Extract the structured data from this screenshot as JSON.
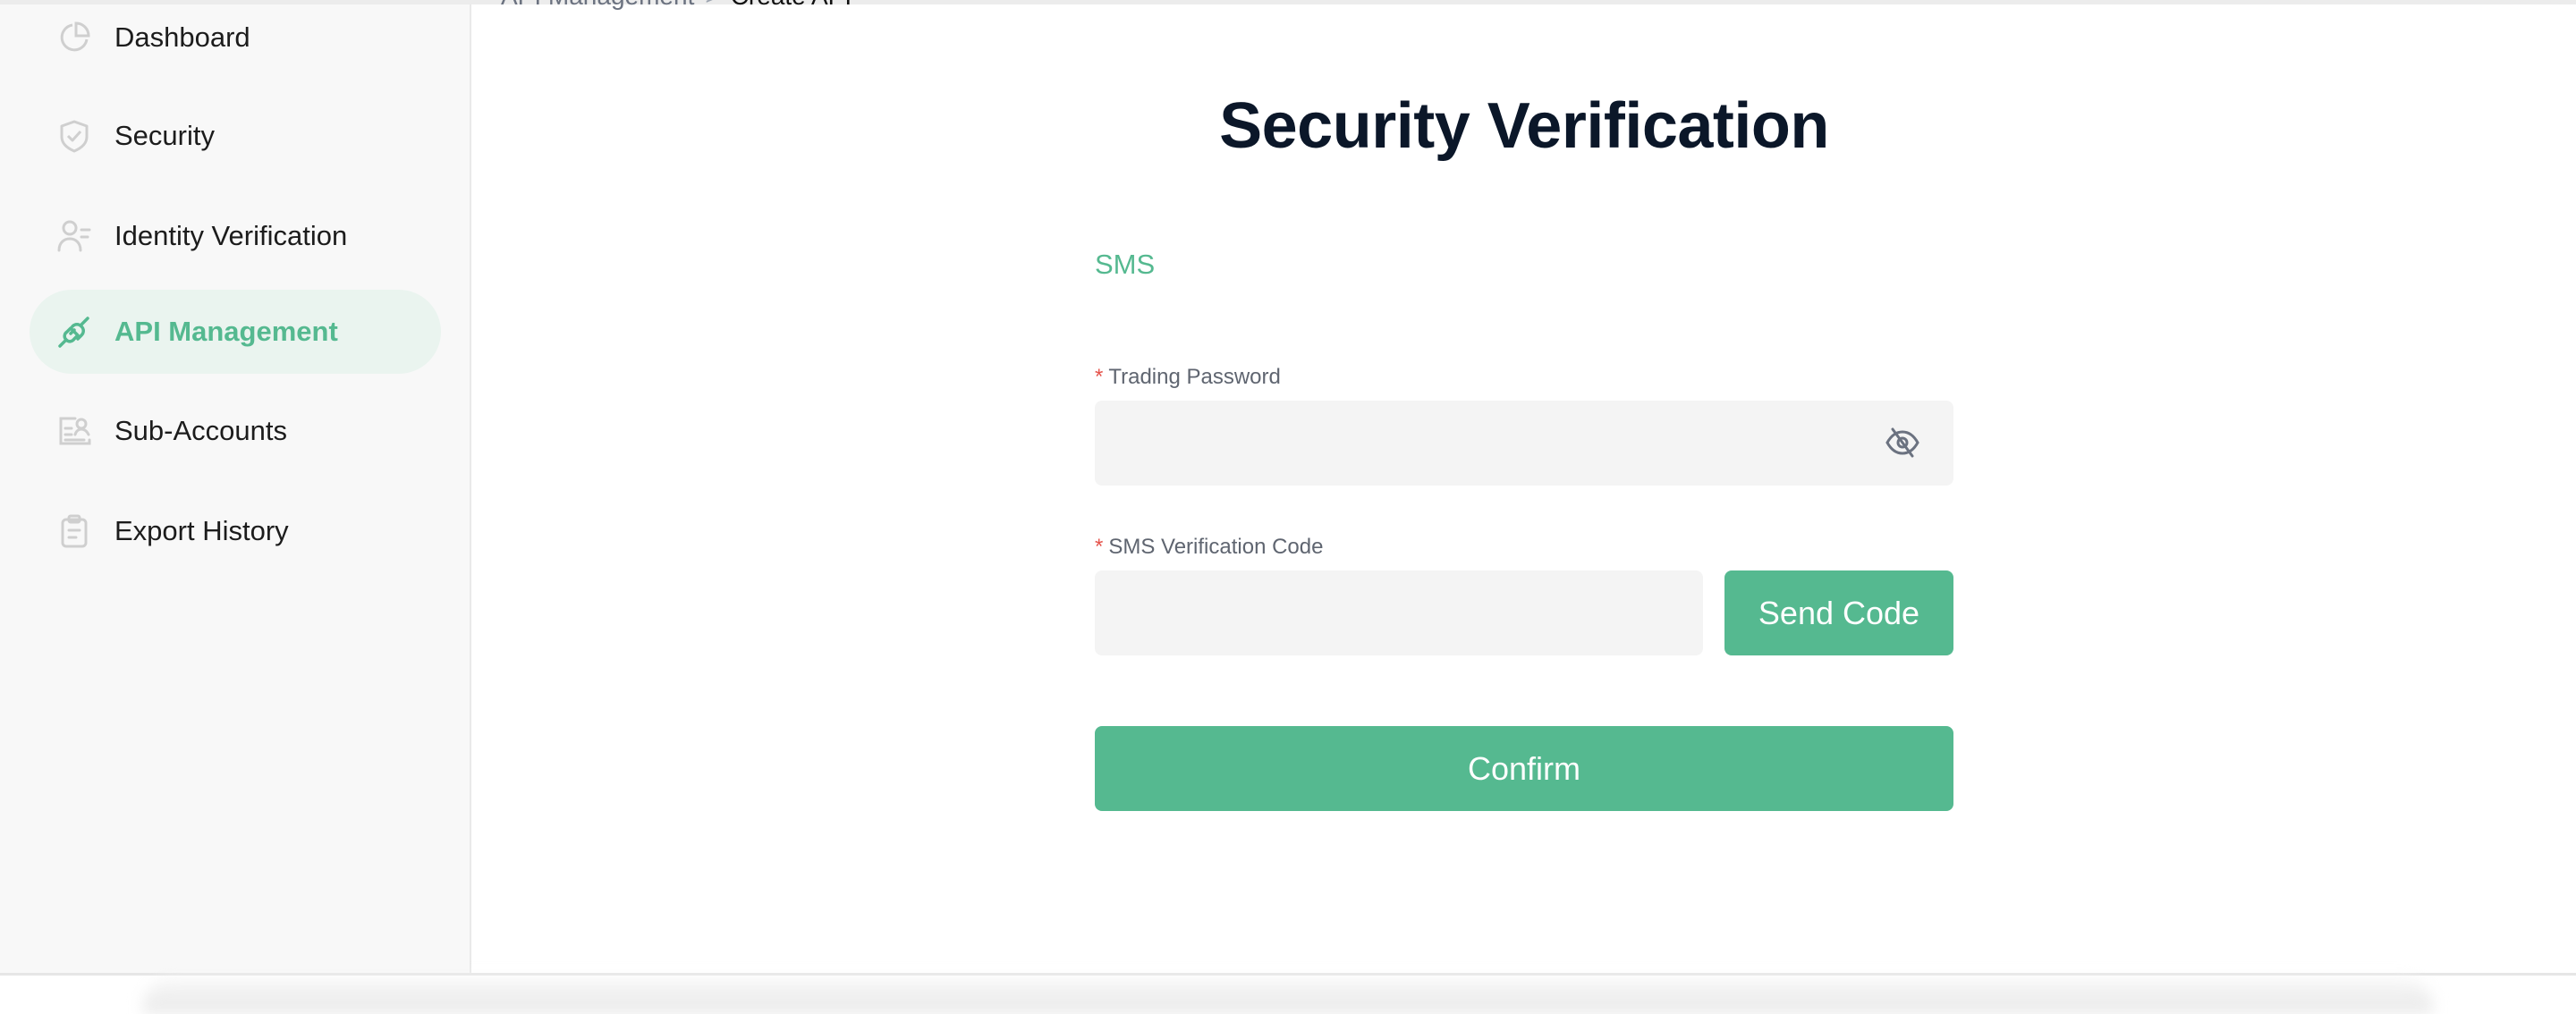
{
  "breadcrumb": {
    "parent": "API Management",
    "separator": ">",
    "current": "Create API"
  },
  "sidebar": {
    "active_color": "#55b990",
    "items": [
      {
        "label": "Dashboard",
        "icon": "pie-chart-icon",
        "active": false
      },
      {
        "label": "Security",
        "icon": "shield-check-icon",
        "active": false
      },
      {
        "label": "Identity Verification",
        "icon": "user-list-icon",
        "active": false
      },
      {
        "label": "API Management",
        "icon": "plug-icon",
        "active": true
      },
      {
        "label": "Sub-Accounts",
        "icon": "id-card-icon",
        "active": false
      },
      {
        "label": "Export History",
        "icon": "clipboard-icon",
        "active": false
      }
    ]
  },
  "main": {
    "title": "Security Verification",
    "method_tab": "SMS",
    "trading_password": {
      "required_mark": "*",
      "label": "Trading Password",
      "value": "",
      "placeholder": "",
      "toggle_icon": "eye-off-icon"
    },
    "sms_code": {
      "required_mark": "*",
      "label": "SMS Verification Code",
      "value": "",
      "placeholder": "",
      "send_button": "Send Code"
    },
    "confirm_button": "Confirm"
  },
  "colors": {
    "accent": "#55b990",
    "title": "#0b1729",
    "required": "#e5534b",
    "input_bg": "#f4f4f4"
  }
}
